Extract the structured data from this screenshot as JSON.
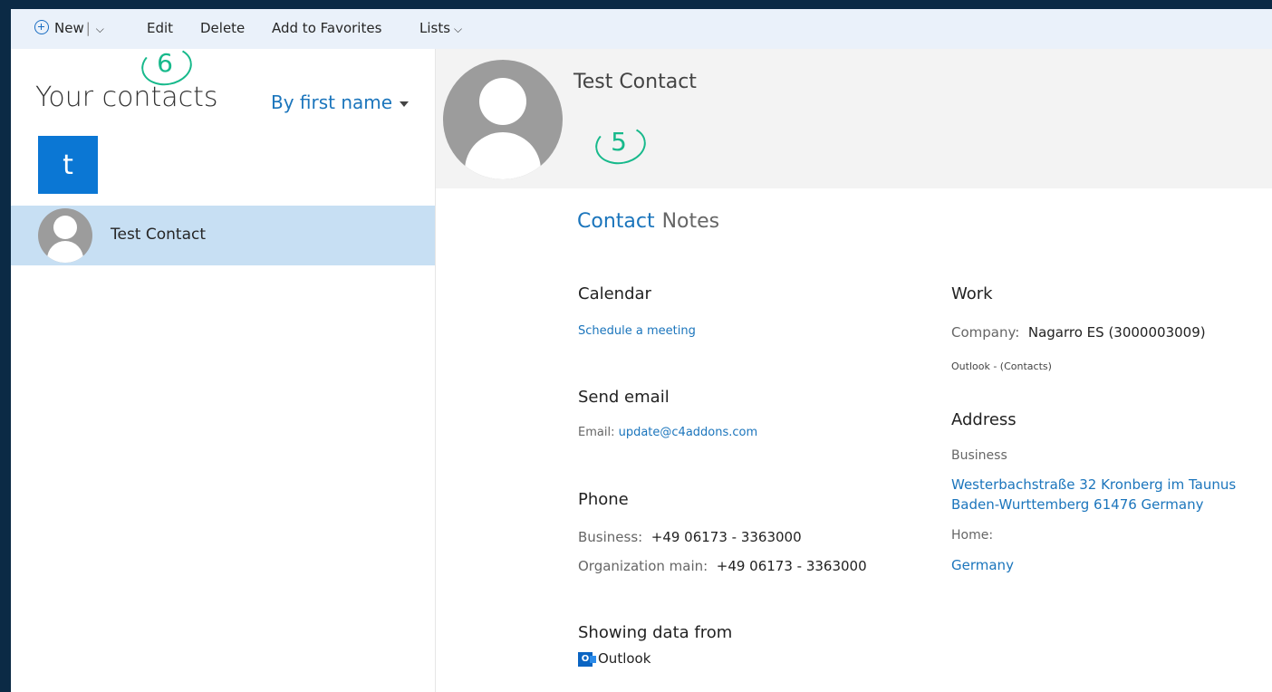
{
  "toolbar": {
    "new_label": "New",
    "edit_label": "Edit",
    "delete_label": "Delete",
    "favorites_label": "Add to Favorites",
    "lists_label": "Lists"
  },
  "left": {
    "title": "Your contacts",
    "sort_label": "By first name",
    "group_letter": "t",
    "contact_name": "Test Contact"
  },
  "header": {
    "name": "Test Contact"
  },
  "tabs": {
    "contact": "Contact",
    "notes": "Notes"
  },
  "calendar": {
    "heading": "Calendar",
    "schedule_link": "Schedule a meeting"
  },
  "email": {
    "heading": "Send email",
    "label": "Email:",
    "address": "update@c4addons.com"
  },
  "phone": {
    "heading": "Phone",
    "business_label": "Business:",
    "business_value": "+49 06173 - 3363000",
    "org_label": "Organization main:",
    "org_value": "+49 06173 - 3363000"
  },
  "source": {
    "heading": "Showing data from",
    "icon_letter": "O",
    "name": "Outlook"
  },
  "work": {
    "heading": "Work",
    "company_label": "Company:",
    "company_value": "Nagarro ES (3000003009)",
    "source_note": "Outlook - (Contacts)"
  },
  "address": {
    "heading": "Address",
    "business_label": "Business",
    "business_line1": "Westerbachstraße 32 Kronberg im Taunus",
    "business_line2": "Baden-Wurttemberg 61476 Germany",
    "home_label": "Home:",
    "home_value": "Germany"
  },
  "annotations": {
    "six": "6",
    "five": "5"
  },
  "colors": {
    "accent": "#1b75bc",
    "selection": "#c7dff3",
    "annotation": "#17b98b"
  }
}
